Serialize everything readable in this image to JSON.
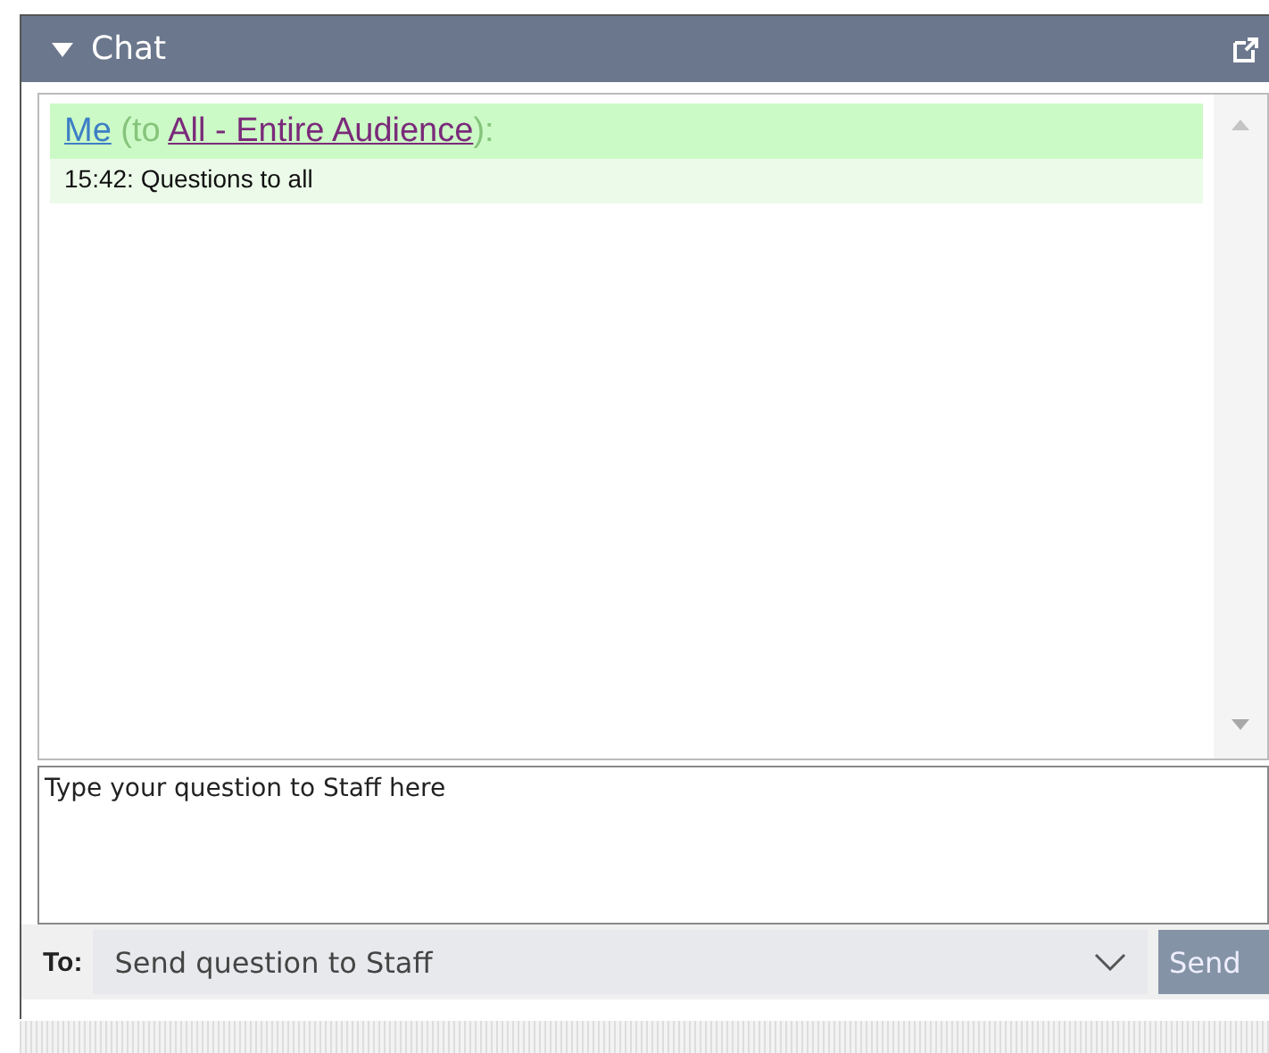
{
  "panel": {
    "title": "Chat",
    "expanded": true
  },
  "messages": [
    {
      "sender": "Me",
      "to_prefix": "(to ",
      "recipient": "All - Entire Audience",
      "to_suffix": "):",
      "text": "15:42: Questions to all"
    }
  ],
  "composer": {
    "placeholder": "Type your question to Staff here"
  },
  "recipient": {
    "label": "To:",
    "value": "Send question to Staff"
  },
  "send_button": "Send"
}
